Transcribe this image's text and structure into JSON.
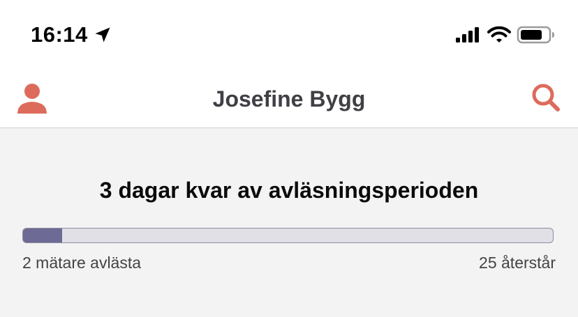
{
  "status_bar": {
    "time": "16:14",
    "icons": [
      "location-arrow-icon",
      "cellular-signal-icon",
      "wifi-icon",
      "battery-icon"
    ]
  },
  "header": {
    "title": "Josefine Bygg",
    "left_icon": "profile-icon",
    "right_icon": "search-icon",
    "accent_color": "#dd6b5c"
  },
  "reading_period": {
    "title": "3 dagar kvar av avläsningsperioden",
    "progress_fraction": 0.074,
    "read_label": "2 mätare avlästa",
    "remaining_label": "25 återstår",
    "fill_color": "#6d6a95",
    "track_color": "#e0e0e6"
  }
}
